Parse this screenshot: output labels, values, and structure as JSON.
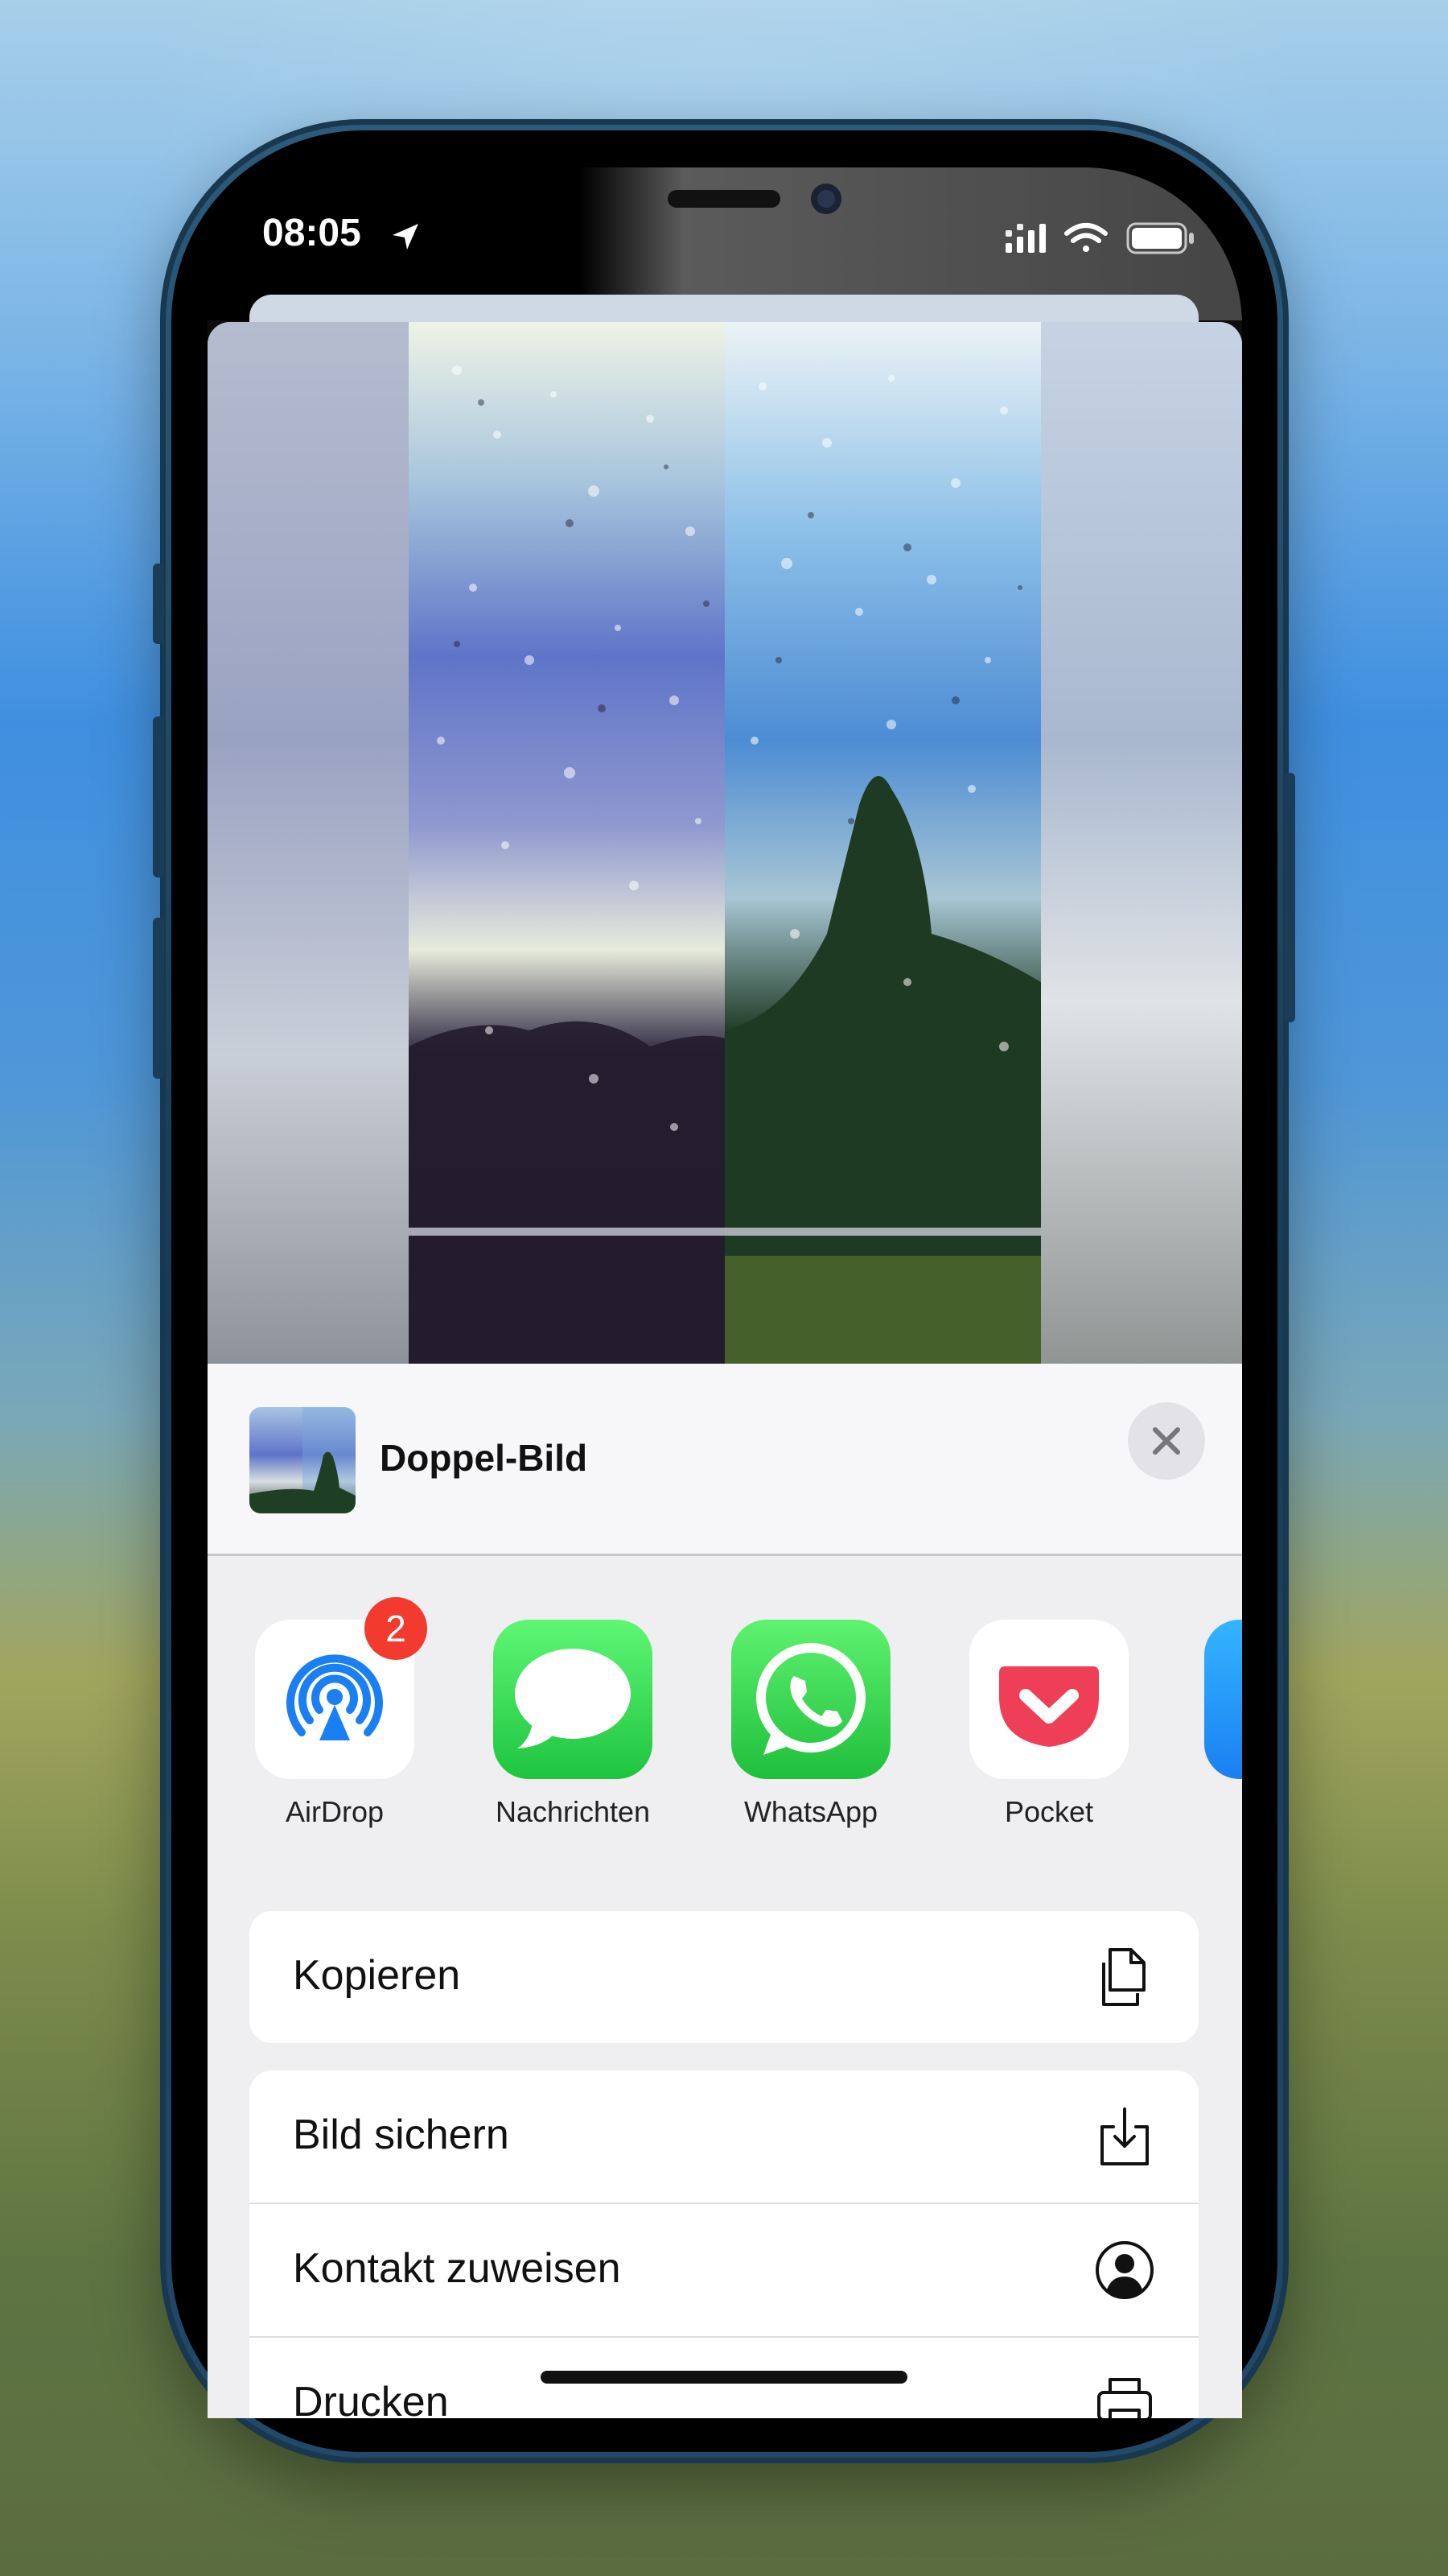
{
  "status_bar": {
    "time": "08:05"
  },
  "share_sheet": {
    "title": "Doppel-Bild",
    "apps": [
      {
        "label": "AirDrop",
        "icon": "airdrop-icon",
        "badge": "2",
        "color": "#1a7ff2"
      },
      {
        "label": "Nachrichten",
        "icon": "messages-icon",
        "color": "#2fcc51"
      },
      {
        "label": "WhatsApp",
        "icon": "whatsapp-icon",
        "color": "#2ad04a"
      },
      {
        "label": "Pocket",
        "icon": "pocket-icon",
        "color": "#ef3f56"
      }
    ],
    "actions": [
      {
        "label": "Kopieren",
        "icon": "copy-icon"
      },
      {
        "label": "Bild sichern",
        "icon": "save-image-icon"
      },
      {
        "label": "Kontakt zuweisen",
        "icon": "contact-icon"
      },
      {
        "label": "Drucken",
        "icon": "print-icon"
      }
    ]
  }
}
